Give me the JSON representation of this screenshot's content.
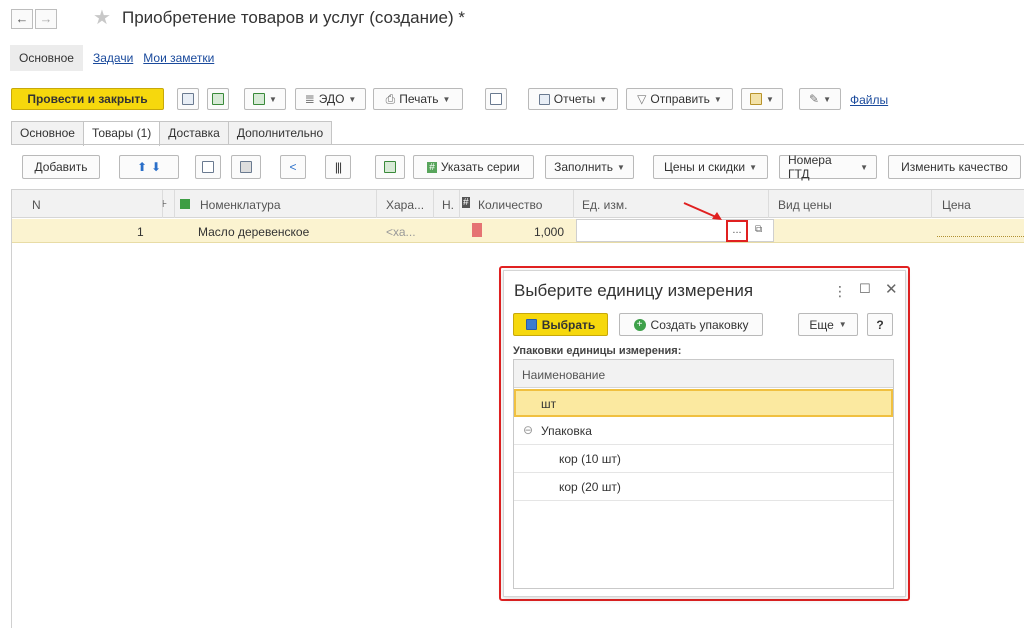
{
  "window": {
    "title": "Приобретение товаров и услуг (создание) *",
    "back": "←",
    "forward": "→",
    "star": "★"
  },
  "subnav": {
    "active": "Основное",
    "links": [
      "Задачи",
      "Мои заметки"
    ]
  },
  "toolbar": {
    "post_close": "Провести и закрыть",
    "edo": "ЭДО",
    "print": "Печать",
    "reports": "Отчеты",
    "send": "Отправить",
    "files": "Файлы"
  },
  "tabs": [
    "Основное",
    "Товары (1)",
    "Доставка",
    "Дополнительно"
  ],
  "table_toolbar": {
    "add": "Добавить",
    "series": "Указать серии",
    "fill": "Заполнить",
    "prices": "Цены и скидки",
    "gtd": "Номера ГТД",
    "quality": "Изменить качество"
  },
  "grid": {
    "headers": {
      "n": "N",
      "flag": "F",
      "nom": "Номенклатура",
      "char": "Хара...",
      "h": "Н.",
      "qty": "Количество",
      "unit": "Ед. изм.",
      "price_type": "Вид цены",
      "price": "Цена"
    },
    "row": {
      "n": "1",
      "nom": "Масло деревенское",
      "char": "<ха...",
      "qty": "1,000",
      "sel_btn": "..."
    }
  },
  "popup": {
    "title": "Выберите единицу измерения",
    "select": "Выбрать",
    "create": "Создать упаковку",
    "more": "Еще",
    "help": "?",
    "list_label": "Упаковки единицы измерения:",
    "col_header": "Наименование",
    "rows": [
      {
        "label": "шт"
      },
      {
        "label": "Упаковка"
      },
      {
        "label": "кор (10 шт)"
      },
      {
        "label": "кор (20 шт)"
      }
    ]
  },
  "colors": {
    "primary_yellow": "#f6d80d",
    "highlight_red": "#e22222",
    "link_blue": "#1a4a9c",
    "row_yellow": "#fbf3d0"
  }
}
